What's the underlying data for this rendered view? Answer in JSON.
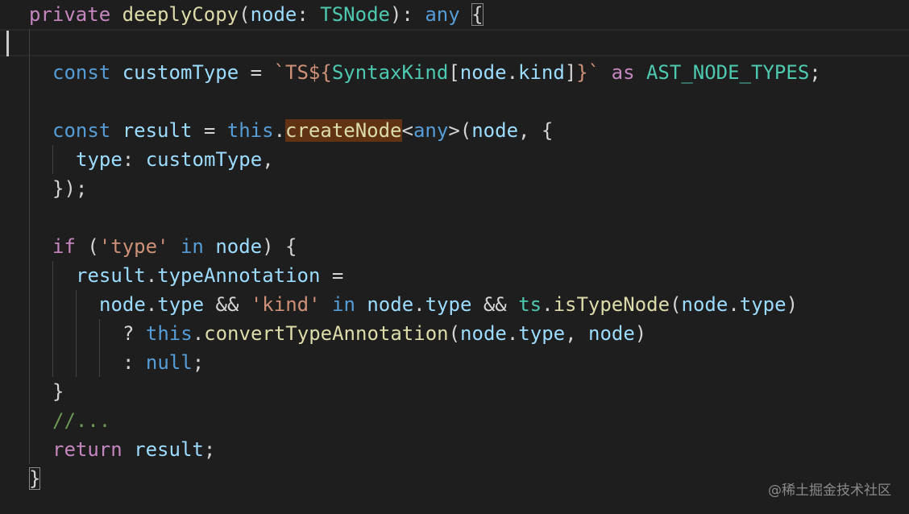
{
  "code": {
    "line1": {
      "kw_private": "private",
      "fn": "deeplyCopy",
      "open_paren": "(",
      "param": "node",
      "colon": ": ",
      "param_type": "TSNode",
      "close": "): ",
      "ret_type": "any",
      "brace": "{"
    },
    "line3": {
      "kw_const": "const",
      "name": "customType",
      "eq": " = ",
      "tpl_start": "`TS${",
      "syntaxkind": "SyntaxKind",
      "bracket_open": "[",
      "node": "node",
      "dot": ".",
      "kind": "kind",
      "bracket_close": "]",
      "tpl_end": "}`",
      "kw_as": "as",
      "type": "AST_NODE_TYPES",
      "semi": ";"
    },
    "line5": {
      "kw_const": "const",
      "name": "result",
      "eq": " = ",
      "kw_this": "this",
      "dot": ".",
      "method": "createNode",
      "lt": "<",
      "generic": "any",
      "gt_paren": ">(",
      "arg": "node",
      "rest": ", {"
    },
    "line6": {
      "prop": "type",
      "colon": ": ",
      "value": "customType",
      "comma": ","
    },
    "line7": {
      "text": "});"
    },
    "line9": {
      "kw_if": "if",
      "open": " (",
      "str": "'type'",
      "kw_in": "in",
      "obj": "node",
      "close": ") {"
    },
    "line10": {
      "obj": "result",
      "dot": ".",
      "prop": "typeAnnotation",
      "eq": " ="
    },
    "line11": {
      "a_obj": "node",
      "a_dot": ".",
      "a_prop": "type",
      "and1": " && ",
      "str": "'kind'",
      "kw_in": "in",
      "b_obj": "node",
      "b_dot": ".",
      "b_prop": "type",
      "and2": " && ",
      "ts": "ts",
      "c_dot": ".",
      "fn": "isTypeNode",
      "open": "(",
      "c_obj": "node",
      "c_dot2": ".",
      "c_prop": "type",
      "close": ")"
    },
    "line12": {
      "q": "? ",
      "kw_this": "this",
      "dot": ".",
      "fn": "convertTypeAnnotation",
      "open": "(",
      "a_obj": "node",
      "a_dot": ".",
      "a_prop": "type",
      "comma": ", ",
      "b_obj": "node",
      "close": ")"
    },
    "line13": {
      "colon": ": ",
      "kw_null": "null",
      "semi": ";"
    },
    "line14": {
      "text": "}"
    },
    "line15": {
      "comment": "//..."
    },
    "line16": {
      "kw_return": "return",
      "value": "result",
      "semi": ";"
    },
    "line17": {
      "text": "}"
    }
  },
  "watermark": "@稀土掘金技术社区",
  "colors": {
    "background": "#1e1e1e",
    "keyword": "#569cd6",
    "control": "#c586c0",
    "function": "#dcdcaa",
    "type": "#4ec9b0",
    "variable": "#9cdcfe",
    "string": "#ce9178",
    "comment": "#6a9955",
    "highlight": "#613214"
  }
}
